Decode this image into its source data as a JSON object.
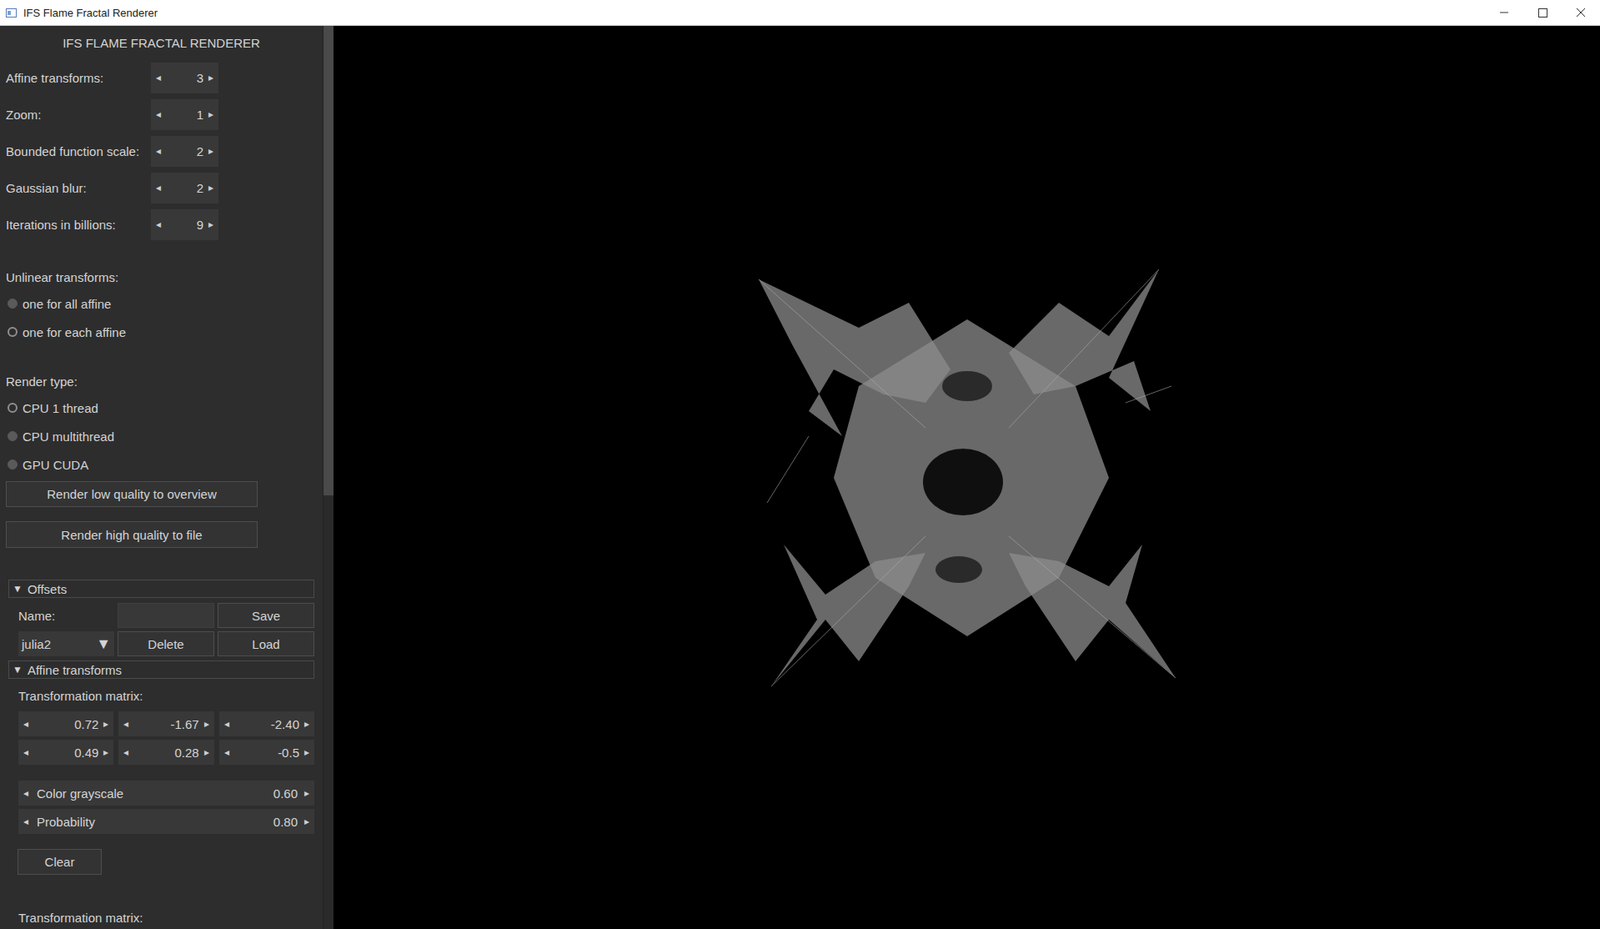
{
  "window": {
    "title": "IFS Flame Fractal Renderer"
  },
  "panel": {
    "title": "IFS FLAME FRACTAL RENDERER",
    "arrows": {
      "left": "◂",
      "right": "▸"
    },
    "spinners": [
      {
        "label": "Affine transforms:",
        "value": "3"
      },
      {
        "label": "Zoom:",
        "value": "1"
      },
      {
        "label": "Bounded function scale:",
        "value": "2"
      },
      {
        "label": "Gaussian blur:",
        "value": "2"
      },
      {
        "label": "Iterations in billions:",
        "value": "9"
      }
    ],
    "unlinear": {
      "label": "Unlinear transforms:",
      "options": [
        {
          "label": "one for all affine",
          "selected": false
        },
        {
          "label": "one for each affine",
          "selected": true
        }
      ]
    },
    "render_type": {
      "label": "Render type:",
      "options": [
        {
          "label": "CPU 1 thread",
          "selected": true
        },
        {
          "label": "CPU multithread",
          "selected": false
        },
        {
          "label": "GPU CUDA",
          "selected": false
        }
      ]
    },
    "buttons": [
      "Render low quality to overview",
      "Render high quality to file"
    ],
    "offsets": {
      "title": "Offsets",
      "expanded": true,
      "toggle": "▼",
      "name_label": "Name:",
      "name_value": "",
      "save": "Save",
      "dropdown": {
        "value": "julia2",
        "arrow": "▼"
      },
      "delete": "Delete",
      "load": "Load"
    },
    "affine": {
      "title": "Affine transforms",
      "expanded": true,
      "toggle": "▼",
      "matrix_label": "Transformation matrix:",
      "matrix": [
        [
          "0.72",
          "-1.67",
          "-2.40"
        ],
        [
          "0.49",
          "0.28",
          "-0.5"
        ]
      ],
      "sliders": [
        {
          "label": "Color grayscale",
          "value": "0.60"
        },
        {
          "label": "Probability",
          "value": "0.80"
        }
      ],
      "clear": "Clear",
      "next_label": "Transformation matrix:"
    }
  },
  "scrollbar": {
    "level": 0.52
  }
}
